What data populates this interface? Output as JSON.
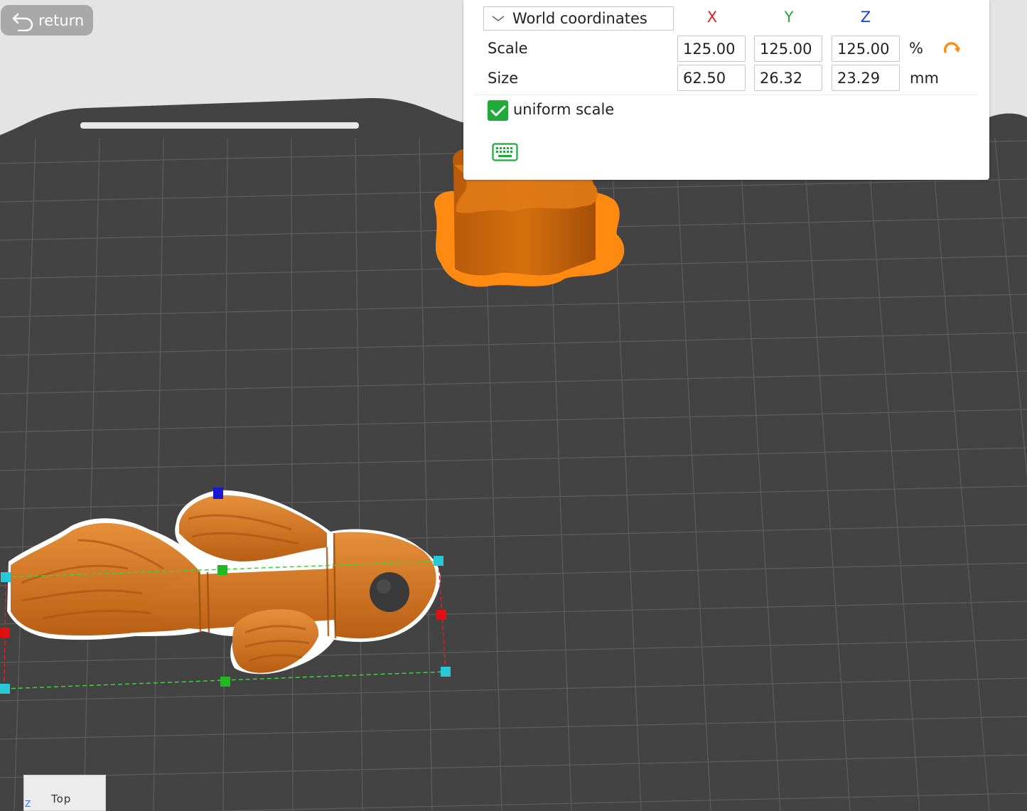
{
  "toolbar": {
    "return_label": "return"
  },
  "panel": {
    "coordinate_mode": "World coordinates",
    "axes": {
      "x": "X",
      "y": "Y",
      "z": "Z"
    },
    "axis_colors": {
      "x": "#e02020",
      "y": "#1faa3a",
      "z": "#1c3fd8"
    },
    "scale": {
      "label": "Scale",
      "x": "125.00",
      "y": "125.00",
      "z": "125.00",
      "unit": "%"
    },
    "size": {
      "label": "Size",
      "x": "62.50",
      "y": "26.32",
      "z": "23.29",
      "unit": "mm"
    },
    "uniform_scale": {
      "label": "uniform scale",
      "checked": true
    }
  },
  "view_cube": {
    "face_label": "Top",
    "axis_label": "Z"
  },
  "colors": {
    "build_plate": "#434343",
    "grid_line": "#5c5c5c",
    "model_orange": "#d9771c",
    "outline_orange": "#ff8a12",
    "accent_green": "#1faa3a"
  }
}
